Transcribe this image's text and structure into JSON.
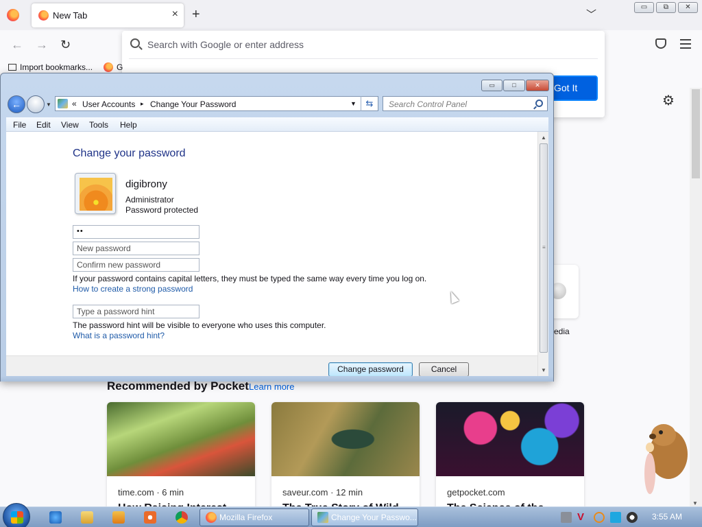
{
  "browser": {
    "tab": {
      "title": "New Tab"
    },
    "new_tab_symbol": "+",
    "tab_list_symbol": "﹀",
    "window_controls": {
      "minimize": "▭",
      "restore": "⧉",
      "close": "✕"
    },
    "nav": {
      "back": "←",
      "forward": "→",
      "reload": "↻"
    },
    "address_placeholder": "Search with Google or enter address",
    "got_it_label": "Got It",
    "bookmarks": {
      "import_label": "Import bookmarks...",
      "ff_label": "G"
    },
    "settings_glyph": "⚙",
    "shortcut_label": "edia"
  },
  "pocket": {
    "heading": "Recommended by Pocket",
    "learn_more": "Learn more",
    "cards": [
      {
        "source": "time.com · 6 min",
        "title": "How Raising Interest",
        "thumb": "thumb-veg"
      },
      {
        "source": "saveur.com · 12 min",
        "title": "The True Story of Wild",
        "thumb": "thumb-marsh"
      },
      {
        "source": "getpocket.com",
        "title": "The Science of the",
        "thumb": "thumb-orbs"
      }
    ]
  },
  "dialog": {
    "breadcrumb": {
      "chevrons": "«",
      "part1": "User Accounts",
      "sep": "▸",
      "part2": "Change Your Password"
    },
    "search_placeholder": "Search Control Panel",
    "menu": [
      "File",
      "Edit",
      "View",
      "Tools",
      "Help"
    ],
    "heading": "Change your password",
    "user": {
      "name": "digibrony",
      "role": "Administrator",
      "status": "Password protected"
    },
    "fields": {
      "current_value": "••",
      "new_placeholder": "New password",
      "confirm_placeholder": "Confirm new password",
      "hint_placeholder": "Type a password hint"
    },
    "notes": {
      "caps": "If your password contains capital letters, they must be typed the same way every time you log on.",
      "strong_link": "How to create a strong password",
      "hint_note": "The password hint will be visible to everyone who uses this computer.",
      "hint_link": "What is a password hint?"
    },
    "buttons": {
      "change": "Change password",
      "cancel": "Cancel"
    }
  },
  "taskbar": {
    "tasks": [
      {
        "label": "Mozilla Firefox"
      },
      {
        "label": "Change Your Passwo..."
      }
    ],
    "clock": "3:55 AM"
  }
}
